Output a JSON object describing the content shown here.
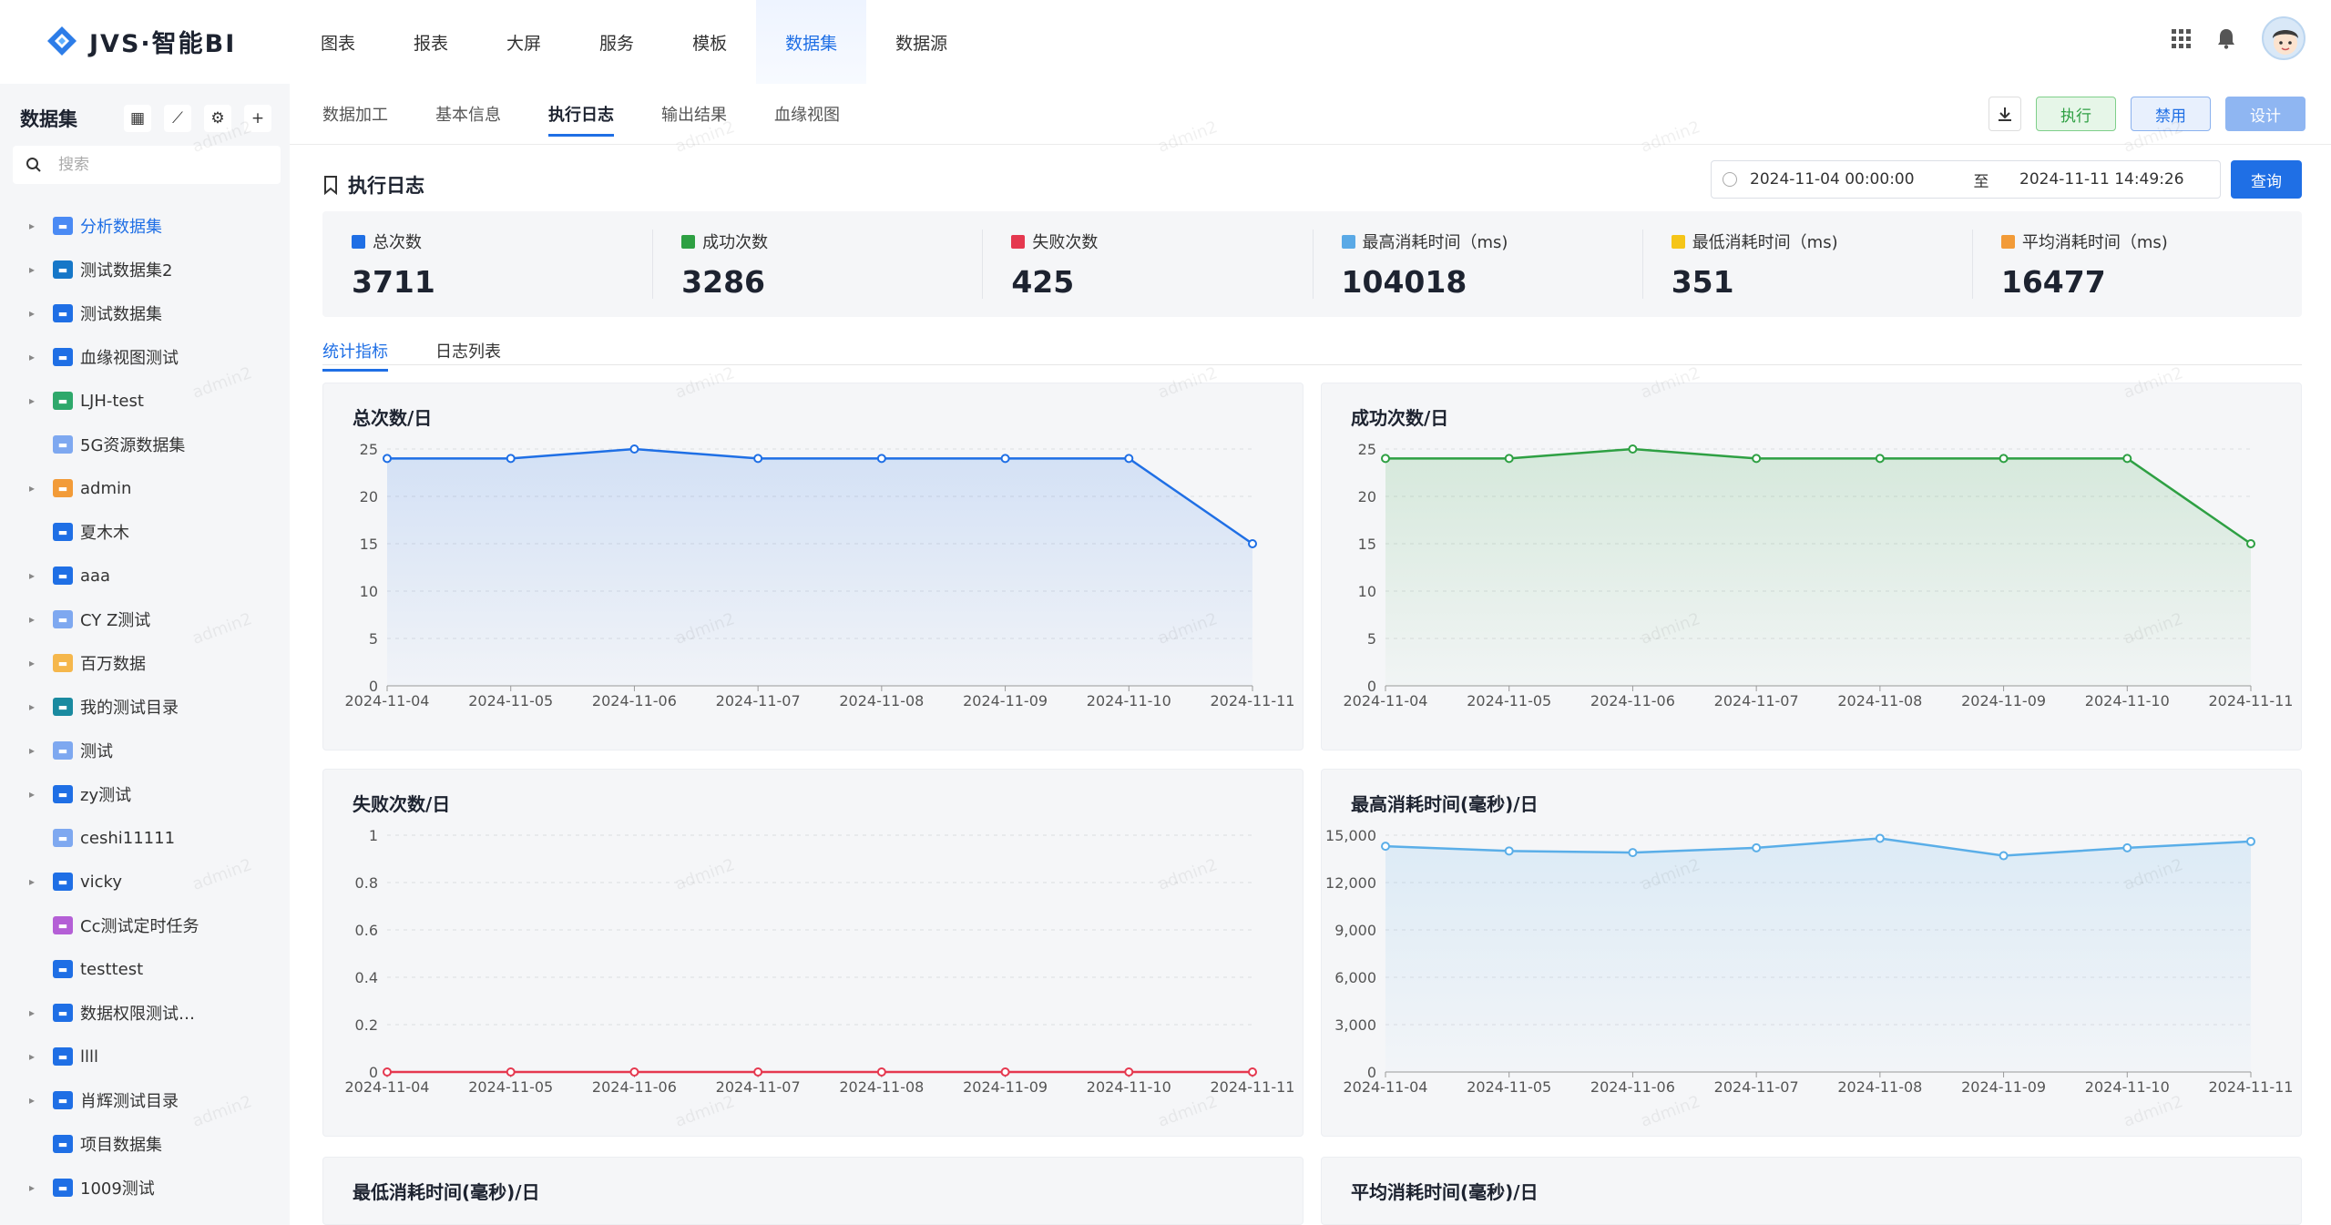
{
  "app": {
    "logo_text": "JVS·智能BI",
    "nav": [
      "图表",
      "报表",
      "大屏",
      "服务",
      "模板",
      "数据集",
      "数据源"
    ],
    "nav_active": 5
  },
  "sidebar": {
    "title": "数据集",
    "search_placeholder": "搜索",
    "items": [
      {
        "label": "分析数据集",
        "caret": true,
        "icon_color": "#4a8af4",
        "active": true
      },
      {
        "label": "测试数据集2",
        "caret": true,
        "icon_color": "#1677c8"
      },
      {
        "label": "测试数据集",
        "caret": true,
        "icon_color": "#1f6fe5"
      },
      {
        "label": "血缘视图测试",
        "caret": true,
        "icon_color": "#1f6fe5"
      },
      {
        "label": "LJH-test",
        "caret": true,
        "icon_color": "#2ea86b"
      },
      {
        "label": "5G资源数据集",
        "caret": false,
        "icon_color": "#7ea8f0"
      },
      {
        "label": "admin",
        "caret": true,
        "icon_color": "#f29b38"
      },
      {
        "label": "夏木木",
        "caret": false,
        "icon_color": "#1f6fe5"
      },
      {
        "label": "aaa",
        "caret": true,
        "icon_color": "#1f6fe5"
      },
      {
        "label": "CY Z测试",
        "caret": true,
        "icon_color": "#7ea8f0"
      },
      {
        "label": "百万数据",
        "caret": true,
        "icon_color": "#f5b74c"
      },
      {
        "label": "我的测试目录",
        "caret": true,
        "icon_color": "#1a8aa0"
      },
      {
        "label": "测试",
        "caret": true,
        "icon_color": "#7ea8f0"
      },
      {
        "label": "zy测试",
        "caret": true,
        "icon_color": "#1f6fe5"
      },
      {
        "label": "ceshi11111",
        "caret": false,
        "icon_color": "#7ea8f0"
      },
      {
        "label": "vicky",
        "caret": true,
        "icon_color": "#1f6fe5"
      },
      {
        "label": "Cc测试定时任务",
        "caret": false,
        "icon_color": "#b45fd6"
      },
      {
        "label": "testtest",
        "caret": false,
        "icon_color": "#1f6fe5"
      },
      {
        "label": "数据权限测试…",
        "caret": true,
        "icon_color": "#1f6fe5"
      },
      {
        "label": "llll",
        "caret": true,
        "icon_color": "#1f6fe5"
      },
      {
        "label": "肖辉测试目录",
        "caret": true,
        "icon_color": "#1f6fe5"
      },
      {
        "label": "项目数据集",
        "caret": false,
        "icon_color": "#1f6fe5"
      },
      {
        "label": "1009测试",
        "caret": true,
        "icon_color": "#1f6fe5"
      }
    ]
  },
  "subtabs": [
    "数据加工",
    "基本信息",
    "执行日志",
    "输出结果",
    "血缘视图"
  ],
  "subtab_active": 2,
  "actions": {
    "run": "执行",
    "disable": "禁用",
    "design": "设计"
  },
  "log": {
    "title": "执行日志",
    "date_from": "2024-11-04 00:00:00",
    "date_sep": "至",
    "date_to": "2024-11-11 14:49:26",
    "query": "查询"
  },
  "stats": [
    {
      "label": "总次数",
      "value": "3711",
      "color": "#1f6fe5"
    },
    {
      "label": "成功次数",
      "value": "3286",
      "color": "#2ea043"
    },
    {
      "label": "失败次数",
      "value": "425",
      "color": "#e5384f"
    },
    {
      "label": "最高消耗时间（ms)",
      "value": "104018",
      "color": "#5aa9e6"
    },
    {
      "label": "最低消耗时间（ms)",
      "value": "351",
      "color": "#f5c518"
    },
    {
      "label": "平均消耗时间（ms)",
      "value": "16477",
      "color": "#f29b38"
    }
  ],
  "content_tabs": [
    "统计指标",
    "日志列表"
  ],
  "watermark": "admin2",
  "chart_data": [
    {
      "type": "area",
      "title": "总次数/日",
      "color": "#1f6fe5",
      "categories": [
        "2024-11-04",
        "2024-11-05",
        "2024-11-06",
        "2024-11-07",
        "2024-11-08",
        "2024-11-09",
        "2024-11-10",
        "2024-11-11"
      ],
      "values": [
        24,
        24,
        25,
        24,
        24,
        24,
        24,
        15
      ],
      "ylim": [
        0,
        25
      ],
      "yticks": [
        0,
        5,
        10,
        15,
        20,
        25
      ],
      "ytick_labels": [
        "0",
        "5",
        "10",
        "15",
        "20",
        "25"
      ]
    },
    {
      "type": "area",
      "title": "成功次数/日",
      "color": "#2ea043",
      "categories": [
        "2024-11-04",
        "2024-11-05",
        "2024-11-06",
        "2024-11-07",
        "2024-11-08",
        "2024-11-09",
        "2024-11-10",
        "2024-11-11"
      ],
      "values": [
        24,
        24,
        25,
        24,
        24,
        24,
        24,
        15
      ],
      "ylim": [
        0,
        25
      ],
      "yticks": [
        0,
        5,
        10,
        15,
        20,
        25
      ],
      "ytick_labels": [
        "0",
        "5",
        "10",
        "15",
        "20",
        "25"
      ]
    },
    {
      "type": "line",
      "title": "失败次数/日",
      "color": "#e5384f",
      "categories": [
        "2024-11-04",
        "2024-11-05",
        "2024-11-06",
        "2024-11-07",
        "2024-11-08",
        "2024-11-09",
        "2024-11-10",
        "2024-11-11"
      ],
      "values": [
        0,
        0,
        0,
        0,
        0,
        0,
        0,
        0
      ],
      "ylim": [
        0,
        1
      ],
      "yticks": [
        0,
        0.2,
        0.4,
        0.6,
        0.8,
        1
      ],
      "ytick_labels": [
        "0",
        "0.2",
        "0.4",
        "0.6",
        "0.8",
        "1"
      ]
    },
    {
      "type": "area",
      "title": "最高消耗时间(毫秒)/日",
      "color": "#5aaee8",
      "categories": [
        "2024-11-04",
        "2024-11-05",
        "2024-11-06",
        "2024-11-07",
        "2024-11-08",
        "2024-11-09",
        "2024-11-10",
        "2024-11-11"
      ],
      "values": [
        14300,
        14000,
        13900,
        14200,
        14800,
        13700,
        14200,
        14600
      ],
      "ylim": [
        0,
        15000
      ],
      "yticks": [
        0,
        3000,
        6000,
        9000,
        12000,
        15000
      ],
      "ytick_labels": [
        "0",
        "3,000",
        "6,000",
        "9,000",
        "12,000",
        "15,000"
      ]
    },
    {
      "type": "line",
      "title": "最低消耗时间(毫秒)/日"
    },
    {
      "type": "line",
      "title": "平均消耗时间(毫秒)/日"
    }
  ]
}
